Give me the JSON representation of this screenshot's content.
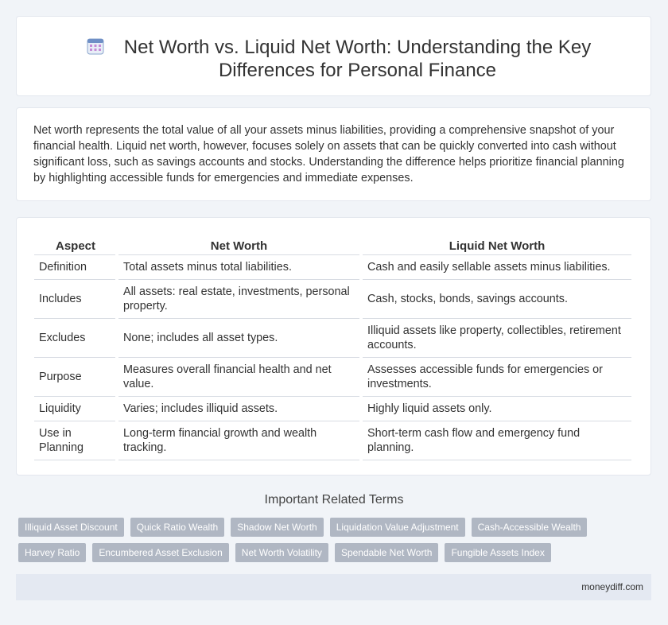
{
  "header": {
    "title": "Net Worth vs. Liquid Net Worth: Understanding the Key Differences for Personal Finance",
    "icon": "calendar-icon"
  },
  "intro": {
    "text": "Net worth represents the total value of all your assets minus liabilities, providing a comprehensive snapshot of your financial health. Liquid net worth, however, focuses solely on assets that can be quickly converted into cash without significant loss, such as savings accounts and stocks. Understanding the difference helps prioritize financial planning by highlighting accessible funds for emergencies and immediate expenses."
  },
  "table": {
    "headers": [
      "Aspect",
      "Net Worth",
      "Liquid Net Worth"
    ],
    "rows": [
      [
        "Definition",
        "Total assets minus total liabilities.",
        "Cash and easily sellable assets minus liabilities."
      ],
      [
        "Includes",
        "All assets: real estate, investments, personal property.",
        "Cash, stocks, bonds, savings accounts."
      ],
      [
        "Excludes",
        "None; includes all asset types.",
        "Illiquid assets like property, collectibles, retirement accounts."
      ],
      [
        "Purpose",
        "Measures overall financial health and net value.",
        "Assesses accessible funds for emergencies or investments."
      ],
      [
        "Liquidity",
        "Varies; includes illiquid assets.",
        "Highly liquid assets only."
      ],
      [
        "Use in Planning",
        "Long-term financial growth and wealth tracking.",
        "Short-term cash flow and emergency fund planning."
      ]
    ]
  },
  "related": {
    "title": "Important Related Terms",
    "row1": [
      "Illiquid Asset Discount",
      "Quick Ratio Wealth",
      "Shadow Net Worth",
      "Liquidation Value Adjustment",
      "Cash-Accessible Wealth"
    ],
    "row2": [
      "Harvey Ratio",
      "Encumbered Asset Exclusion",
      "Net Worth Volatility",
      "Spendable Net Worth",
      "Fungible Assets Index"
    ]
  },
  "footer": {
    "site": "moneydiff.com"
  },
  "colors": {
    "background": "#f1f4f8",
    "tag": "#b0b7c3",
    "footer": "#e4e9f2"
  }
}
